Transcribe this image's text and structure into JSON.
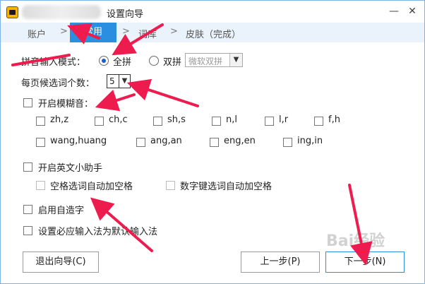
{
  "window": {
    "title": "设置向导",
    "minimize_glyph": "—",
    "close_glyph": "✕"
  },
  "steps": [
    {
      "label": "账户"
    },
    {
      "label": "常用",
      "active": true
    },
    {
      "label": "词库"
    },
    {
      "label": "皮肤（完成）"
    }
  ],
  "step_sep": ">",
  "pinyin_mode": {
    "label": "拼音输入模式：",
    "options": [
      {
        "label": "全拼",
        "selected": true
      },
      {
        "label": "双拼",
        "selected": false
      }
    ],
    "shuangpin_scheme": "微软双拼"
  },
  "candidates": {
    "label": "每页候选词个数：",
    "value": "5"
  },
  "fuzzy": {
    "label": "开启模糊音：",
    "checked": false,
    "pairs_row1": [
      "zh,z",
      "ch,c",
      "sh,s",
      "n,l",
      "l,r",
      "f,h"
    ],
    "pairs_row2": [
      "wang,huang",
      "ang,an",
      "eng,en",
      "ing,in"
    ]
  },
  "english_helper": {
    "label": "开启英文小助手",
    "sub_options": [
      "空格选词自动加空格",
      "数字键选词自动加空格"
    ]
  },
  "auto_word": {
    "label": "启用自造字"
  },
  "set_default": {
    "label": "设置必应输入法为默认输入法"
  },
  "buttons": {
    "exit": "退出向导(C)",
    "prev": "上一步(P)",
    "next": "下一步(N)"
  },
  "watermark": "Bai经验",
  "colors": {
    "accent": "#2a8fe1",
    "annotation_arrow": "#ee1c4e",
    "step_bar": "#eaf3fb"
  }
}
